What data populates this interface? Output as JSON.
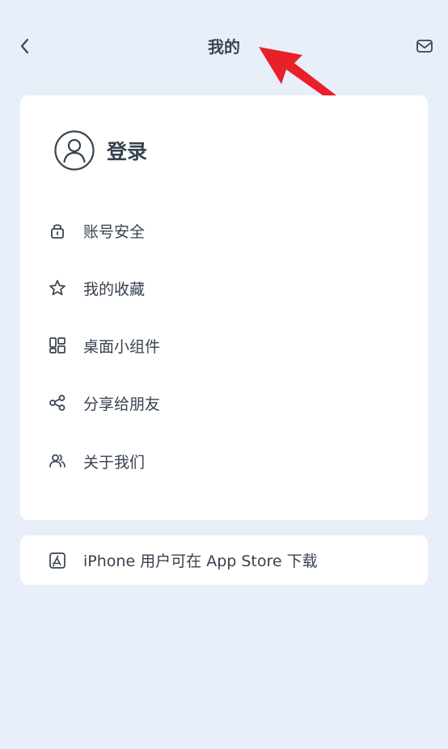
{
  "header": {
    "title": "我的",
    "back_icon": "chevron-left-icon",
    "mail_icon": "mail-icon"
  },
  "profile": {
    "login_label": "登录",
    "avatar_icon": "user-circle-icon"
  },
  "menu": {
    "items": [
      {
        "label": "账号安全",
        "icon": "lock-icon"
      },
      {
        "label": "我的收藏",
        "icon": "star-icon"
      },
      {
        "label": "桌面小组件",
        "icon": "widgets-icon"
      },
      {
        "label": "分享给朋友",
        "icon": "share-icon"
      },
      {
        "label": "关于我们",
        "icon": "users-icon"
      }
    ]
  },
  "appstore": {
    "label": "iPhone 用户可在 App Store 下载",
    "icon": "app-store-icon"
  },
  "colors": {
    "background": "#e9eff8",
    "card": "#ffffff",
    "text": "#37434f",
    "annotation_arrow": "#e8202a"
  }
}
